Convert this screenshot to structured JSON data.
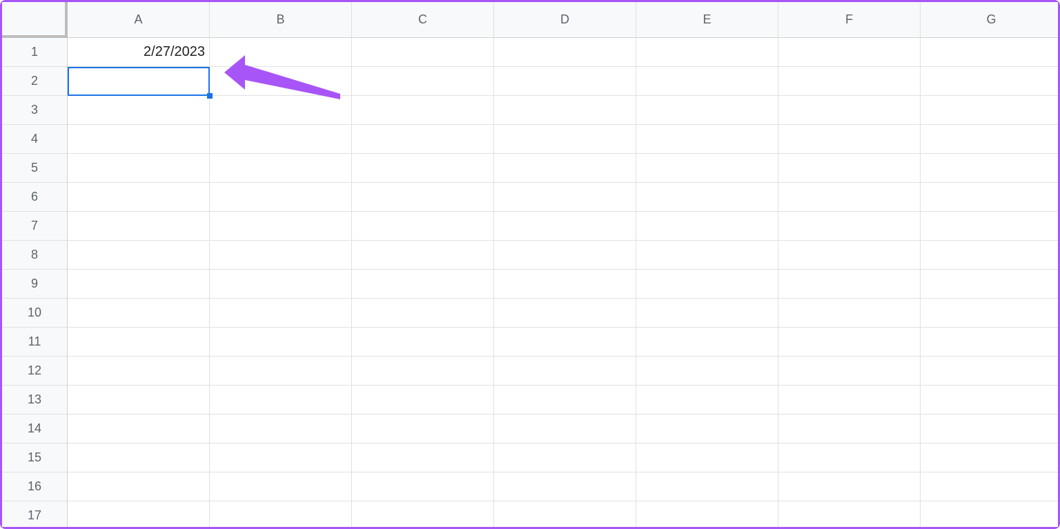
{
  "columns": [
    "A",
    "B",
    "C",
    "D",
    "E",
    "F",
    "G"
  ],
  "rowCount": 17,
  "cells": {
    "A1": "2/27/2023"
  },
  "selected": {
    "col": "A",
    "row": 2
  },
  "annotation": {
    "type": "arrow",
    "color": "#a855f7"
  }
}
